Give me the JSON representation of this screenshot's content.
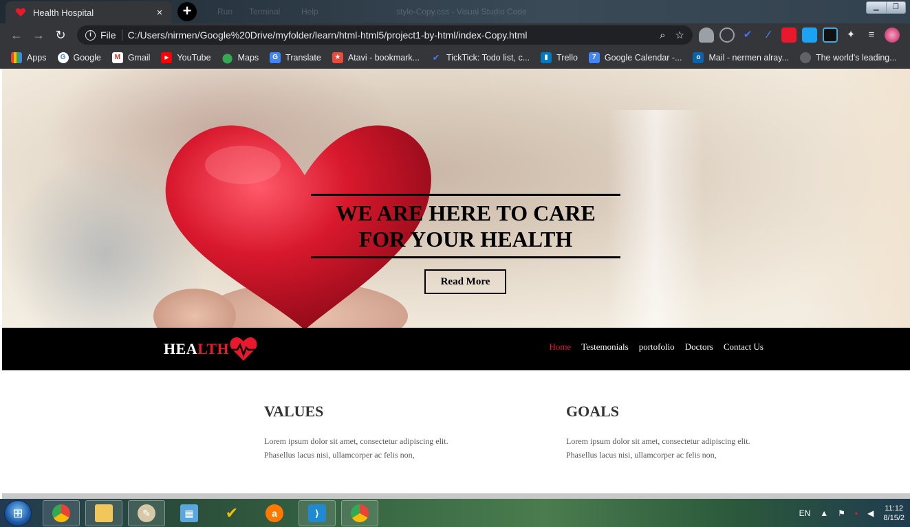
{
  "browser": {
    "tab_title": "Health Hospital",
    "tab_close": "×",
    "new_tab": "+",
    "background_titlebar_items": [
      "Run",
      "Terminal",
      "Help",
      "style-Copy.css - Visual Studio Code"
    ],
    "scheme_label": "File",
    "url": "C:/Users/nirmen/Google%20Drive/myfolder/learn/html-html5/project1-by-html/index-Copy.html"
  },
  "bookmarks": [
    {
      "label": "Apps",
      "icon": "apps-grid-icon",
      "color": "#e8eaed"
    },
    {
      "label": "Google",
      "icon": "google-icon",
      "color": "#ffffff"
    },
    {
      "label": "Gmail",
      "icon": "gmail-icon",
      "color": "#d93025"
    },
    {
      "label": "YouTube",
      "icon": "youtube-icon",
      "color": "#ff0000"
    },
    {
      "label": "Maps",
      "icon": "maps-icon",
      "color": "#34a853"
    },
    {
      "label": "Translate",
      "icon": "translate-icon",
      "color": "#4285f4"
    },
    {
      "label": "Atavi - bookmark...",
      "icon": "atavi-icon",
      "color": "#e84b3c"
    },
    {
      "label": "TickTick: Todo list, c...",
      "icon": "ticktick-icon",
      "color": "#4772fa"
    },
    {
      "label": "Trello",
      "icon": "trello-icon",
      "color": "#0079bf"
    },
    {
      "label": "Google Calendar -...",
      "icon": "calendar-icon",
      "color": "#4285f4"
    },
    {
      "label": "Mail - nermen alray...",
      "icon": "outlook-icon",
      "color": "#0a64ad"
    },
    {
      "label": "The world's leading...",
      "icon": "github-icon",
      "color": "#5f6368"
    }
  ],
  "hero": {
    "title_line1": "WE ARE HERE TO CARE",
    "title_line2": "FOR YOUR HEALTH",
    "button": "Read More"
  },
  "navbar": {
    "logo_white": "HEA",
    "logo_red": "LTH",
    "links": [
      "Home",
      "Testemonials",
      "portofolio",
      "Doctors",
      "Contact Us"
    ],
    "active": "Home"
  },
  "sections": {
    "values": {
      "title": "VALUES",
      "line1": "Lorem ipsum dolor sit amet, consectetur adipiscing elit.",
      "line2": "Phasellus lacus nisi, ullamcorper ac felis non,"
    },
    "goals": {
      "title": "GOALS",
      "line1": "Lorem ipsum dolor sit amet, consectetur adipiscing elit.",
      "line2": "Phasellus lacus nisi, ullamcorper ac felis non,"
    }
  },
  "taskbar": {
    "language": "EN",
    "time": "11:12",
    "date": "8/15/2",
    "apps": [
      "chrome-icon",
      "file-explorer-icon",
      "paint-icon",
      "control-panel-icon",
      "ticktick-icon",
      "avast-icon",
      "vscode-icon",
      "chrome-profile-icon"
    ]
  },
  "colors": {
    "brand_red": "#e8192c",
    "navbar_bg": "#000000",
    "chrome_dark": "#35363a"
  }
}
